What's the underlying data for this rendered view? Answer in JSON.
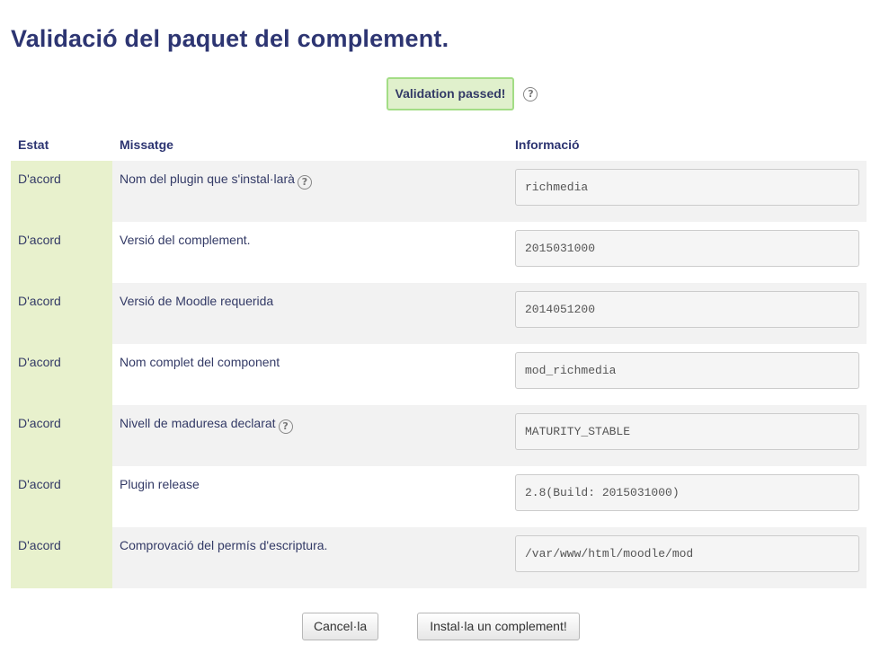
{
  "page": {
    "title": "Validació del paquet del complement."
  },
  "status": {
    "label": "Validation passed!",
    "help_icon": "question-circle-icon"
  },
  "table": {
    "headers": {
      "status": "Estat",
      "message": "Missatge",
      "info": "Informació"
    },
    "rows": [
      {
        "status": "D'acord",
        "message": "Nom del plugin que s'instal·larà",
        "info": "richmedia",
        "has_help": true
      },
      {
        "status": "D'acord",
        "message": "Versió del complement.",
        "info": "2015031000",
        "has_help": false
      },
      {
        "status": "D'acord",
        "message": "Versió de Moodle requerida",
        "info": "2014051200",
        "has_help": false
      },
      {
        "status": "D'acord",
        "message": "Nom complet del component",
        "info": "mod_richmedia",
        "has_help": false
      },
      {
        "status": "D'acord",
        "message": "Nivell de maduresa declarat",
        "info": "MATURITY_STABLE",
        "has_help": true
      },
      {
        "status": "D'acord",
        "message": "Plugin release",
        "info": "2.8(Build: 2015031000)",
        "has_help": false
      },
      {
        "status": "D'acord",
        "message": "Comprovació del permís d'escriptura.",
        "info": "/var/www/html/moodle/mod",
        "has_help": false
      }
    ]
  },
  "buttons": {
    "cancel": "Cancel·la",
    "install": "Instal·la un complement!"
  },
  "colors": {
    "status_ok_bg": "#e8f1cd",
    "badge_bg": "#e0f0cc",
    "badge_border": "#a3dd86",
    "title": "#2d3572"
  }
}
